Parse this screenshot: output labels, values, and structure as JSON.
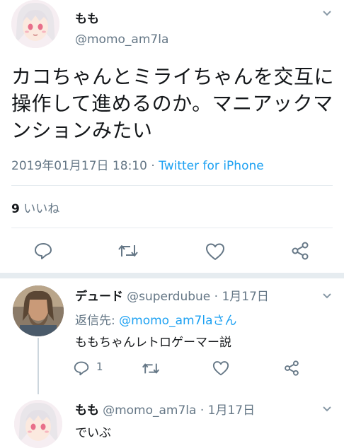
{
  "main_tweet": {
    "display_name": "もも",
    "handle": "@momo_am7la",
    "text": "カコちゃんとミライちゃんを交互に操作して進めるのか。マニアックマンションみたい",
    "timestamp": "2019年01月17日 18:10",
    "separator": " · ",
    "client": "Twitter for iPhone",
    "like_count": "9",
    "like_label": "いいね"
  },
  "reply_1": {
    "display_name": "デュード",
    "handle": "@superdubue",
    "date": " · 1月17日",
    "reply_prefix": "返信先: ",
    "reply_mention": "@momo_am7laさん",
    "text": "ももちゃんレトロゲーマー説",
    "reply_count": "1"
  },
  "reply_2": {
    "display_name": "もも",
    "handle": "@momo_am7la",
    "date": " · 1月17日",
    "text": "でいぶ"
  },
  "icons": [
    "reply-icon",
    "retweet-icon",
    "like-icon",
    "share-icon",
    "chevron-down-icon"
  ]
}
